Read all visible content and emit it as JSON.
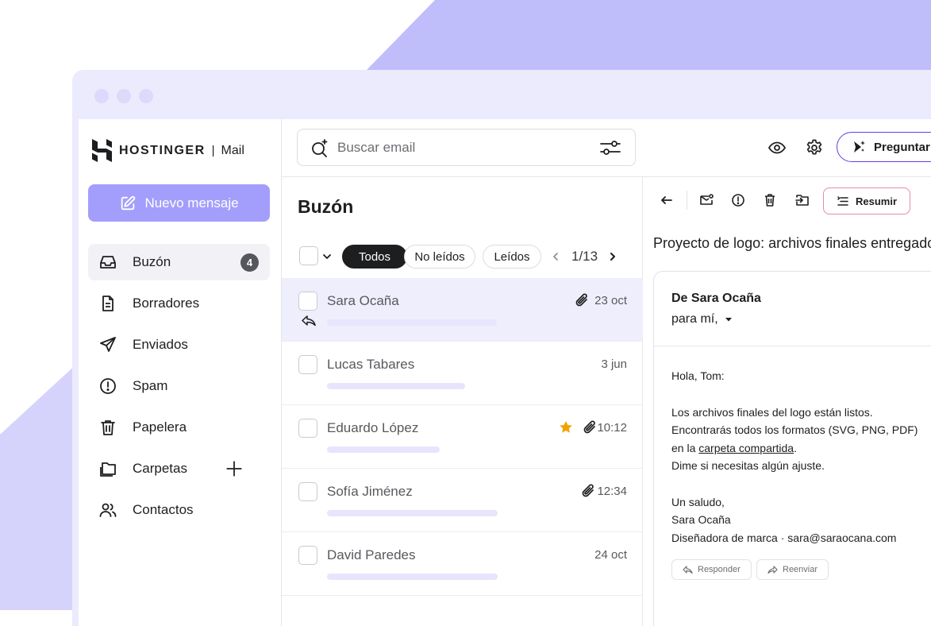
{
  "brand": {
    "name": "HOSTINGER",
    "separator": "|",
    "product": "Mail"
  },
  "compose": {
    "label": "Nuevo mensaje"
  },
  "nav": [
    {
      "label": "Buzón",
      "icon": "inbox-icon",
      "badge": "4",
      "active": true
    },
    {
      "label": "Borradores",
      "icon": "draft-icon"
    },
    {
      "label": "Enviados",
      "icon": "send-icon"
    },
    {
      "label": "Spam",
      "icon": "spam-icon"
    },
    {
      "label": "Papelera",
      "icon": "trash-icon"
    },
    {
      "label": "Carpetas",
      "icon": "folder-icon"
    },
    {
      "label": "Contactos",
      "icon": "contacts-icon"
    }
  ],
  "search": {
    "placeholder": "Buscar email"
  },
  "topbar": {
    "ask_label": "Preguntar"
  },
  "list": {
    "title": "Buzón",
    "filters": [
      "Todos",
      "No leídos",
      "Leídos"
    ],
    "pager": "1/13",
    "rows": [
      {
        "sender": "Sara Ocaña",
        "date": "23 oct",
        "attachment": true,
        "starred": false,
        "replied": true,
        "selected": true
      },
      {
        "sender": "Lucas Tabares",
        "date": "3 jun",
        "attachment": false,
        "starred": false
      },
      {
        "sender": "Eduardo López",
        "date": "10:12",
        "attachment": true,
        "starred": true
      },
      {
        "sender": "Sofía Jiménez",
        "date": "12:34",
        "attachment": true,
        "starred": false
      },
      {
        "sender": "David Paredes",
        "date": "24 oct",
        "attachment": false,
        "starred": false
      }
    ]
  },
  "reader": {
    "summarize_label": "Resumir",
    "subject": "Proyecto de logo: archivos finales entregados",
    "from": "De Sara Ocaña",
    "to": "para mí,",
    "greeting": "Hola, Tom:",
    "p1_line1": "Los archivos finales del logo están listos.",
    "p1_line2": "Encontrarás todos los formatos (SVG, PNG, PDF)",
    "p1_line3_pre": "en la ",
    "p1_link": "carpeta compartida",
    "p1_line3_post": ".",
    "p1_line4": "Dime si necesitas algún ajuste.",
    "closing": "Un saludo,",
    "signature_name": "Sara Ocaña",
    "signature_title": "Diseñadora de marca · sara@saraocana.com",
    "reply_label": "Responder",
    "forward_label": "Reenviar"
  },
  "colors": {
    "accent": "#a39efb",
    "brand": "#673de6",
    "selected_row": "#efeefd",
    "star": "#f4a100"
  }
}
